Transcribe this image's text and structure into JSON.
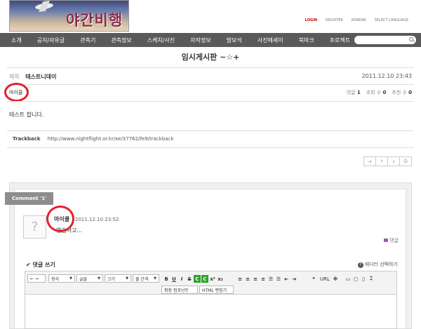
{
  "header": {
    "logo_text": "야간비행",
    "links": [
      "LOGIN",
      "REGISTER",
      "KOREAN",
      "SELECT LANGUAGE"
    ]
  },
  "nav": {
    "items": [
      "소개",
      "공지/자유글",
      "관측기",
      "관측정보",
      "스케치/사진",
      "자작정보",
      "발보석",
      "사진에세이",
      "북마크",
      "프로젝트"
    ],
    "search_placeholder": ""
  },
  "board": {
    "title": "임시게시판 ~☆+"
  },
  "post": {
    "subject_key": "제목",
    "subject": "테스트니데이",
    "date": "2011.12.10 23:43",
    "author": "마이클",
    "stats": {
      "comments_label": "댓글",
      "comments": "1",
      "views_label": "조회 수",
      "views": "0",
      "recommend_label": "추천 수",
      "recommend": "0"
    },
    "body": "테스트 합니다.",
    "trackback_label": "Trackback",
    "trackback_url": "http://www.nightflight.or.kr/xe/37762/fe9/trackback"
  },
  "post_buttons": [
    "⇥",
    "↑",
    "↓",
    "⎙"
  ],
  "comments": {
    "tab_label": "Comment '1'",
    "items": [
      {
        "author": "마이클",
        "date": "2011.12.10 23:52",
        "text": "연습하고..."
      }
    ],
    "reply_label": "댓글"
  },
  "write": {
    "label": "✔ 댓글 쓰기",
    "editor_select": "에디터 선택하기"
  },
  "toolbar": {
    "style_select": "형식",
    "font_select": "글꼴",
    "size_select": "크기",
    "line_select": "줄 간격",
    "buttons": [
      "B",
      "U",
      "I",
      "S",
      "C",
      "C",
      "x²",
      "x₂"
    ],
    "extension_button": "확장 컴포넌트",
    "html_button": "HTML 편집기",
    "url_label": "URL"
  },
  "colors": {
    "nav_bg": "#5a5a5a",
    "highlight_ring": "#e4202a",
    "comment_tab": "#8d8d8d",
    "logo_text": "#8a2a4a"
  }
}
